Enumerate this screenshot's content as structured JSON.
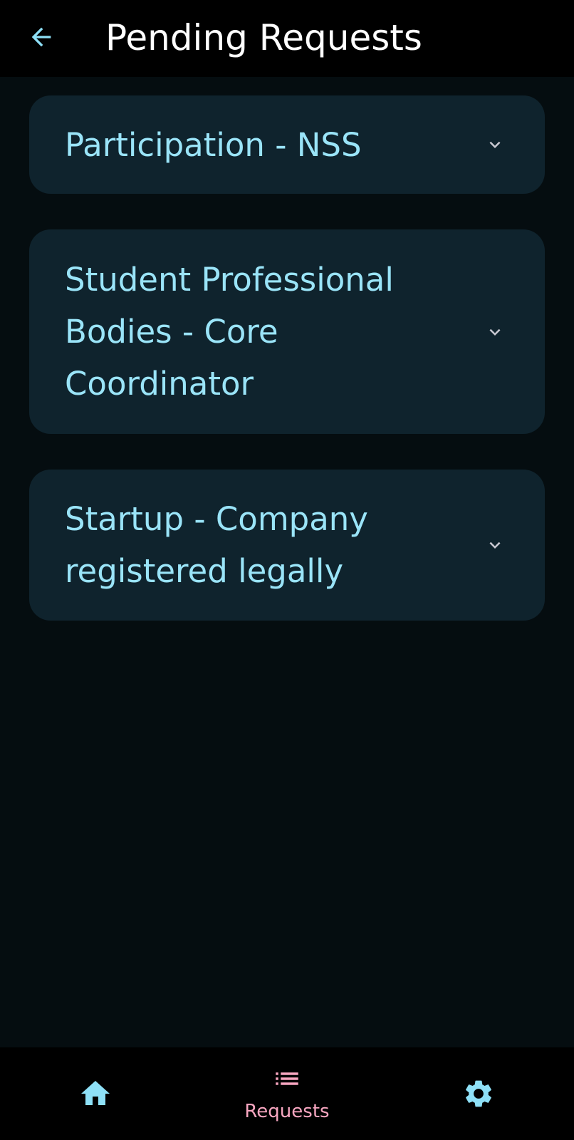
{
  "header": {
    "title": "Pending Requests",
    "back_icon": "arrow-left-icon"
  },
  "requests": [
    {
      "label": "Participation - NSS",
      "icon": "chevron-down-icon"
    },
    {
      "label": "Student Professional Bodies - Core Coordinator",
      "icon": "chevron-down-icon"
    },
    {
      "label": "Startup - Company registered legally",
      "icon": "chevron-down-icon"
    }
  ],
  "bottom_nav": {
    "home": {
      "icon": "home-icon"
    },
    "requests": {
      "icon": "list-icon",
      "label": "Requests",
      "selected": true
    },
    "settings": {
      "icon": "gear-icon"
    }
  },
  "colors": {
    "background": "#050d10",
    "bar": "#000000",
    "card": "#0f232d",
    "card_text": "#9ae4f8",
    "accent_blue": "#8ee0f7",
    "accent_pink": "#f7a6c0",
    "chevron": "#c9c9d2",
    "title": "#ffffff"
  }
}
